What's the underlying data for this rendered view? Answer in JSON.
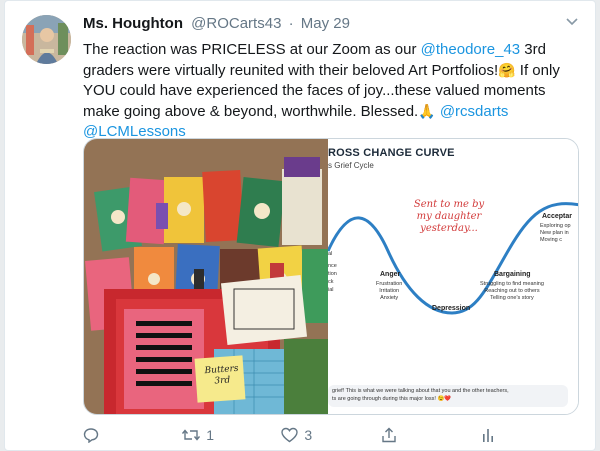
{
  "tweet": {
    "author_name": "Ms. Houghton",
    "handle": "@ROCarts43",
    "separator": "·",
    "date": "May 29",
    "text_parts": {
      "p1": "The reaction was PRICELESS at our Zoom as our ",
      "mention1": "@theodore_43",
      "p2": " 3rd graders were virtually reunited with their beloved Art Portfolios!",
      "emoji_hug": "🤗",
      "p3": " If only YOU could have experienced the faces of joy...these valued moments make going above & beyond, worthwhile. Blessed.",
      "emoji_pray": "🙏",
      "mention2": "@rcsdarts",
      "mention3": "@LCMLessons"
    }
  },
  "media": {
    "slide": {
      "title": "ROSS CHANGE CURVE",
      "subtitle": "s Grief Cycle",
      "handwritten_note": "Sent to me by my daughter yesterday...",
      "left_clip_1": "al",
      "left_clip_2": "nce",
      "left_clip_3": "tion",
      "left_clip_4": "ck",
      "left_clip_5": "ial",
      "anger_label": "Anger",
      "anger_desc_1": "Frustration",
      "anger_desc_2": "Irritation",
      "anger_desc_3": "Anxiety",
      "depression_label": "Depression",
      "bargaining_label": "Bargaining",
      "bargaining_desc_1": "Struggling to find meaning",
      "bargaining_desc_2": "Reaching out to others",
      "bargaining_desc_3": "Telling one's story",
      "acceptance_label": "Acceptar",
      "acceptance_desc_1": "Exploring op",
      "acceptance_desc_2": "New plan in",
      "acceptance_desc_3": "Moving c",
      "chat_line_1": "grief! This is what  we were talking about that you and the other teachers,",
      "chat_line_2": "ts are going through during this major loss!",
      "chat_emojis": "😉❤️"
    },
    "photo_labels": {
      "folder_note_line1": "Butters",
      "folder_note_line2": "3rd"
    }
  },
  "actions": {
    "reply_count": "",
    "retweet_count": "1",
    "like_count": "3"
  },
  "colors": {
    "link": "#1b95e0",
    "muted": "#657786",
    "curve": "#2d7fc4",
    "handwriting": "#d23a3a"
  }
}
